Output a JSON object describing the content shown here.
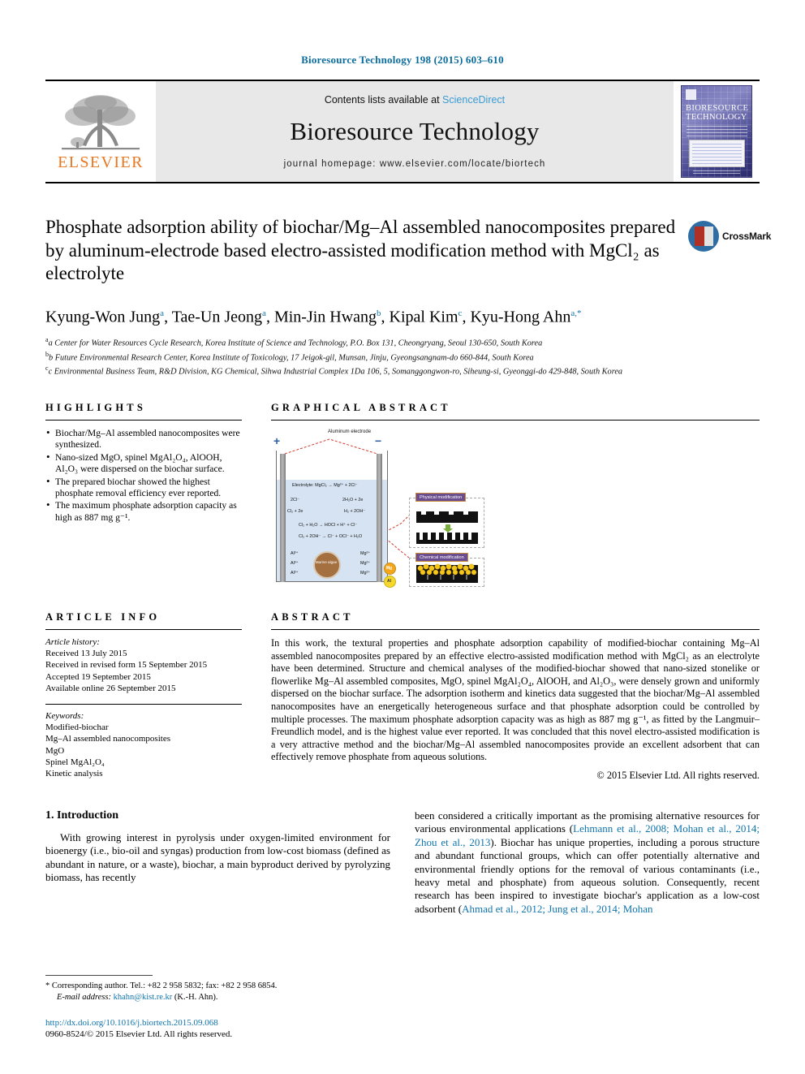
{
  "running_head": "Bioresource Technology 198 (2015) 603–610",
  "masthead": {
    "contents_prefix": "Contents lists available at ",
    "sciencedirect": "ScienceDirect",
    "journal_title": "Bioresource Technology",
    "homepage": "journal homepage: www.elsevier.com/locate/biortech",
    "publisher_name": "ELSEVIER",
    "cover_title_line1": "BIORESOURCE",
    "cover_title_line2": "TECHNOLOGY"
  },
  "article": {
    "title": "Phosphate adsorption ability of biochar/Mg–Al assembled nanocomposites prepared by aluminum-electrode based electro-assisted modification method with MgCl₂ as electrolyte",
    "crossmark_label": "CrossMark",
    "authors_html": "Kyung-Won Jung<sup>a</sup>, Tae-Un Jeong<sup>a</sup>, Min-Jin Hwang<sup>b</sup>, Kipal Kim<sup>c</sup>, Kyu-Hong Ahn<sup>a,*</sup>",
    "affiliations": [
      "a Center for Water Resources Cycle Research, Korea Institute of Science and Technology, P.O. Box 131, Cheongryang, Seoul 130-650, South Korea",
      "b Future Environmental Research Center, Korea Institute of Toxicology, 17 Jeigok-gil, Munsan, Jinju, Gyeongsangnam-do 660-844, South Korea",
      "c Environmental Business Team, R&D Division, KG Chemical, Sihwa Industrial Complex 1Da 106, 5, Somanggongwon-ro, Siheung-si, Gyeonggi-do 429-848, South Korea"
    ]
  },
  "highlights": {
    "heading": "HIGHLIGHTS",
    "items": [
      "Biochar/Mg–Al assembled nanocomposites were synthesized.",
      "Nano-sized MgO, spinel MgAl₂O₄, AlOOH, Al₂O₃ were dispersed on the biochar surface.",
      "The prepared biochar showed the highest phosphate removal efficiency ever reported.",
      "The maximum phosphate adsorption capacity as high as 887 mg g⁻¹."
    ]
  },
  "graphical_abstract": {
    "heading": "GRAPHICAL ABSTRACT",
    "electrode_label": "Aluminum electrode",
    "anode_sign": "+",
    "cathode_sign": "−",
    "equations": [
      "Electrolyte: MgCl₂ → Mg²⁺ + 2Cl⁻",
      "2Cl⁻",
      "Cl₂ + 2e",
      "2H₂O + 2e",
      "H₂ + 2OH⁻",
      "Cl₂ + H₂O → HOCl + H⁺ + Cl⁻",
      "Cl₂ + 2OH⁻ → Cl⁻ + OCl⁻ + H₂O"
    ],
    "ion_rows": [
      {
        "left": "Al³⁺",
        "right": "Mg²⁺"
      },
      {
        "left": "Al³⁺",
        "right": "Mg²⁺"
      },
      {
        "left": "Al³⁺",
        "right": "Mg²⁺"
      }
    ],
    "center_label": "Marine algae",
    "panel_physical": "Physical modification",
    "panel_chemical": "Chemical modification",
    "legend_mg": "Mg",
    "legend_al": "Al"
  },
  "article_info": {
    "heading": "ARTICLE INFO",
    "history_label": "Article history:",
    "history": [
      "Received 13 July 2015",
      "Received in revised form 15 September 2015",
      "Accepted 19 September 2015",
      "Available online 26 September 2015"
    ],
    "keywords_label": "Keywords:",
    "keywords": [
      "Modified-biochar",
      "Mg–Al assembled nanocomposites",
      "MgO",
      "Spinel MgAl₂O₄",
      "Kinetic analysis"
    ]
  },
  "abstract": {
    "heading": "ABSTRACT",
    "text": "In this work, the textural properties and phosphate adsorption capability of modified-biochar containing Mg–Al assembled nanocomposites prepared by an effective electro-assisted modification method with MgCl₂ as an electrolyte have been determined. Structure and chemical analyses of the modified-biochar showed that nano-sized stonelike or flowerlike Mg–Al assembled composites, MgO, spinel MgAl₂O₄, AlOOH, and Al₂O₃, were densely grown and uniformly dispersed on the biochar surface. The adsorption isotherm and kinetics data suggested that the biochar/Mg–Al assembled nanocomposites have an energetically heterogeneous surface and that phosphate adsorption could be controlled by multiple processes. The maximum phosphate adsorption capacity was as high as 887 mg g⁻¹, as fitted by the Langmuir–Freundlich model, and is the highest value ever reported. It was concluded that this novel electro-assisted modification is a very attractive method and the biochar/Mg–Al assembled nanocomposites provide an excellent adsorbent that can effectively remove phosphate from aqueous solutions.",
    "copyright": "© 2015 Elsevier Ltd. All rights reserved."
  },
  "introduction": {
    "heading": "1. Introduction",
    "left_paragraph": "With growing interest in pyrolysis under oxygen-limited environment for bioenergy (i.e., bio-oil and syngas) production from low-cost biomass (defined as abundant in nature, or a waste), biochar, a main byproduct derived by pyrolyzing biomass, has recently",
    "right_para_pre": "been considered a critically important as the promising alternative resources for various environmental applications (",
    "right_ref_1": "Lehmann et al., 2008; Mohan et al., 2014; Zhou et al., 2013",
    "right_para_mid": "). Biochar has unique properties, including a porous structure and abundant functional groups, which can offer potentially alternative and environmental friendly options for the removal of various contaminants (i.e., heavy metal and phosphate) from aqueous solution. Consequently, recent research has been inspired to investigate biochar's application as a low-cost adsorbent (",
    "right_ref_2": "Ahmad et al., 2012; Jung et al., 2014; Mohan"
  },
  "footer": {
    "corresponding_marker": "*",
    "corresponding_text": "Corresponding author. Tel.: +82 2 958 5832; fax: +82 2 958 6854.",
    "email_label": "E-mail address:",
    "email": "khahn@kist.re.kr",
    "email_suffix": "(K.-H. Ahn).",
    "doi": "http://dx.doi.org/10.1016/j.biortech.2015.09.068",
    "issn_line": "0960-8524/© 2015 Elsevier Ltd. All rights reserved."
  },
  "colors": {
    "link": "#0f74ad",
    "running_head": "#0b6c9e",
    "elsevier_orange": "#E87722",
    "sciencedirect": "#3a9bd4",
    "masthead_bg": "#e8e8e8"
  }
}
